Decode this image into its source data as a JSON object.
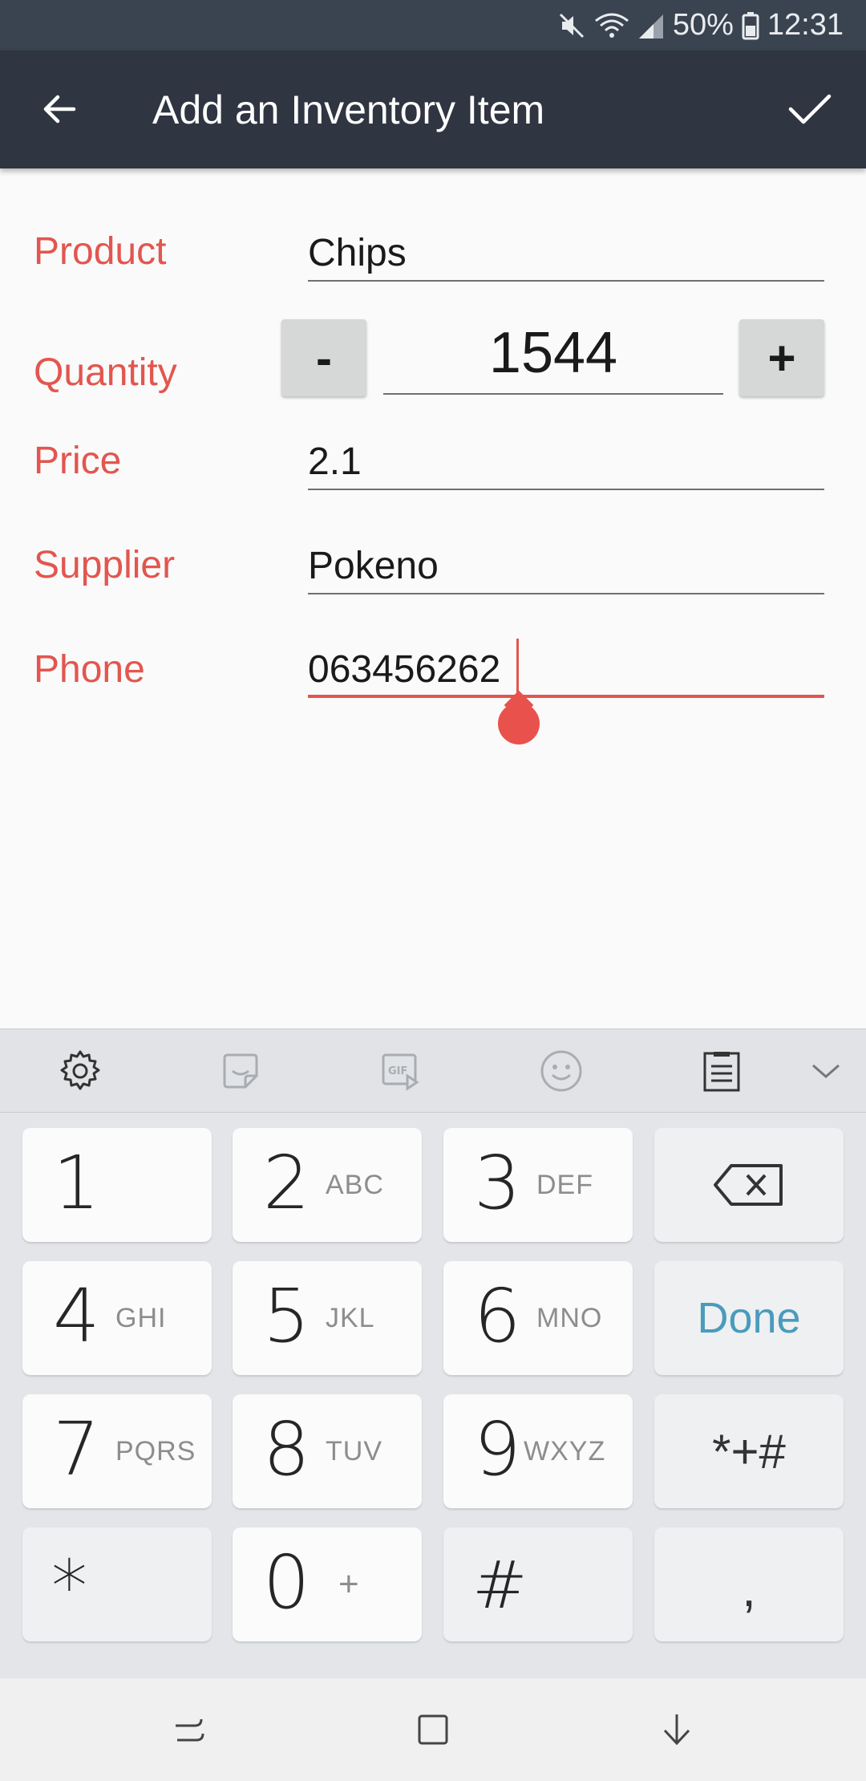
{
  "status_bar": {
    "battery": "50%",
    "time": "12:31",
    "icons": [
      "mute-icon",
      "wifi-icon",
      "signal-icon",
      "battery-icon"
    ]
  },
  "app_bar": {
    "title": "Add an Inventory Item",
    "back_icon": "arrow-left-icon",
    "save_icon": "checkmark-icon"
  },
  "form": {
    "product": {
      "label": "Product",
      "value": "Chips"
    },
    "quantity": {
      "label": "Quantity",
      "value": "1544",
      "minus_label": "-",
      "plus_label": "+"
    },
    "price": {
      "label": "Price",
      "value": "2.1"
    },
    "supplier": {
      "label": "Supplier",
      "value": "Pokeno"
    },
    "phone": {
      "label": "Phone",
      "value": "063456262"
    }
  },
  "keyboard": {
    "toolbar": [
      "settings-icon",
      "sticker-icon",
      "gif-icon",
      "emoji-icon",
      "clipboard-icon",
      "chevron-down-icon"
    ],
    "keys": [
      {
        "digit": "1",
        "letters": ""
      },
      {
        "digit": "2",
        "letters": "ABC"
      },
      {
        "digit": "3",
        "letters": "DEF"
      },
      {
        "digit": "4",
        "letters": "GHI"
      },
      {
        "digit": "5",
        "letters": "JKL"
      },
      {
        "digit": "6",
        "letters": "MNO"
      },
      {
        "digit": "7",
        "letters": "PQRS"
      },
      {
        "digit": "8",
        "letters": "TUV"
      },
      {
        "digit": "9",
        "letters": "WXYZ"
      },
      {
        "digit": "0",
        "letters": "+"
      }
    ],
    "star": "*",
    "hash": "#",
    "done": "Done",
    "symbols": "*+#",
    "comma": ",",
    "done_color": "#4a9bbd"
  },
  "nav_bar": [
    "recents-icon",
    "home-icon",
    "hide-keyboard-icon"
  ]
}
